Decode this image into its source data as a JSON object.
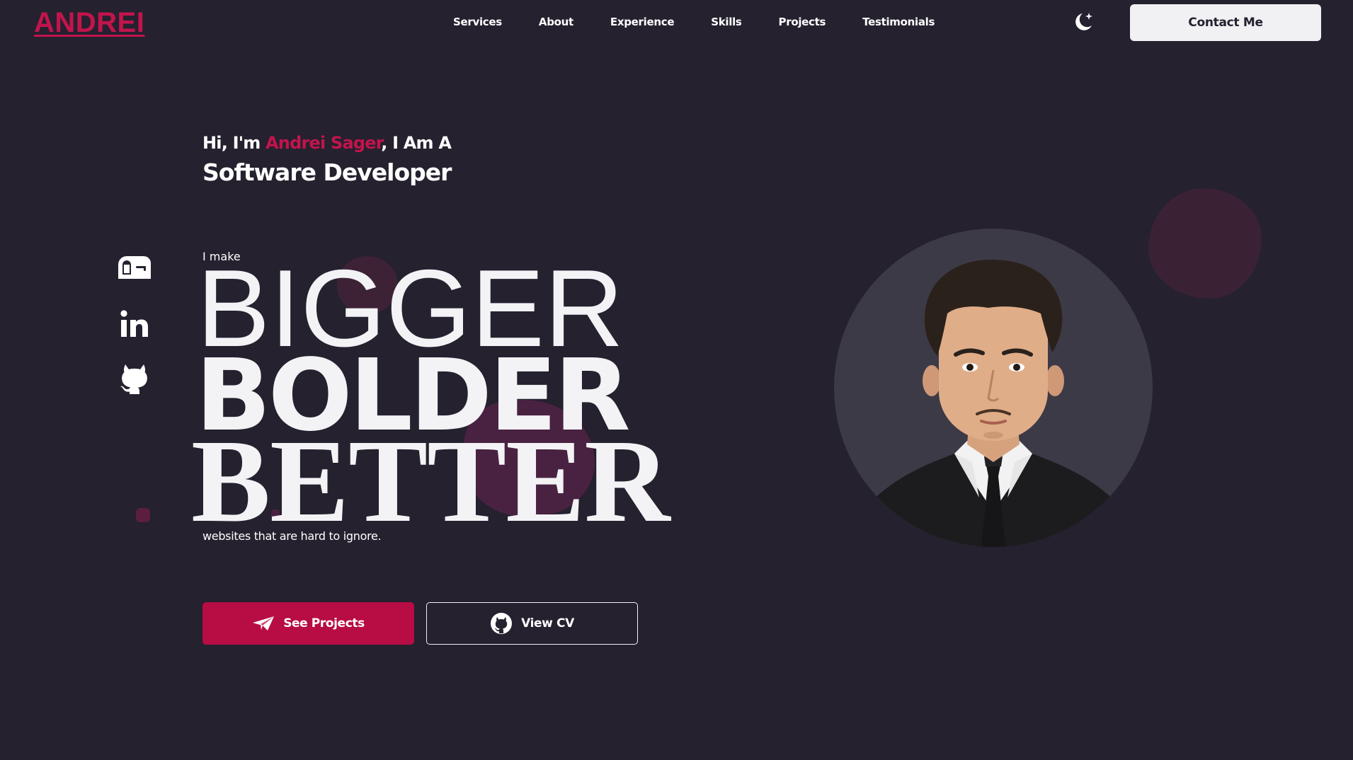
{
  "header": {
    "logo": "ANDREI",
    "nav": [
      {
        "label": "Services"
      },
      {
        "label": "About"
      },
      {
        "label": "Experience"
      },
      {
        "label": "Skills"
      },
      {
        "label": "Projects"
      },
      {
        "label": "Testimonials"
      }
    ],
    "theme_toggle_icon": "moon-star-icon",
    "contact_label": "Contact Me"
  },
  "hero": {
    "greeting_prefix": "Hi, I'm ",
    "name": "Andrei Sager",
    "greeting_suffix": ", I Am A",
    "role": "Software Developer",
    "lead_in": "I make",
    "word_1": "BIGGER",
    "word_2": "BOLDER",
    "word_3": "BETTER",
    "tagline": "websites that are hard to ignore.",
    "primary_button": {
      "label": "See Projects",
      "icon": "paper-plane-icon"
    },
    "secondary_button": {
      "label": "View CV",
      "icon": "github-icon"
    }
  },
  "social": [
    {
      "icon": "mailbox-icon"
    },
    {
      "icon": "linkedin-icon"
    },
    {
      "icon": "github-icon"
    }
  ],
  "colors": {
    "background": "#25212f",
    "accent": "#c2144c",
    "button_primary": "#b70c44",
    "text": "#ffffff",
    "portrait_bg": "#3d3a47"
  }
}
